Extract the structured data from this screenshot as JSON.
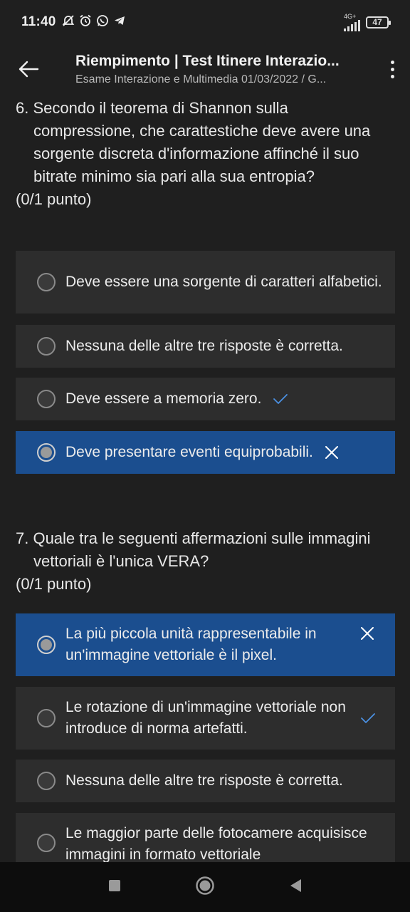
{
  "status_bar": {
    "time": "11:40",
    "network_label": "4G+",
    "battery": "47"
  },
  "app_bar": {
    "title": "Riempimento | Test Itinere Interazio...",
    "subtitle": "Esame Interazione e Multimedia 01/03/2022 / G..."
  },
  "questions": [
    {
      "text": "6. Secondo il teorema di Shannon sulla compressione, che carattestiche deve avere una sorgente discreta d'informazione affinché il suo bitrate minimo sia pari alla sua entropia?",
      "points": "(0/1 punto)",
      "options": [
        {
          "label": "Deve essere una sorgente di caratteri alfabetici.",
          "selected": false,
          "mark": "none"
        },
        {
          "label": "Nessuna delle altre tre risposte è corretta.",
          "selected": false,
          "mark": "none"
        },
        {
          "label": "Deve essere a memoria zero.",
          "selected": false,
          "mark": "correct"
        },
        {
          "label": "Deve presentare eventi equiprobabili.",
          "selected": true,
          "mark": "wrong"
        }
      ]
    },
    {
      "text": "7. Quale tra le seguenti affermazioni sulle immagini vettoriali è l'unica VERA?",
      "points": "(0/1 punto)",
      "options": [
        {
          "label": "La più piccola unità rappresentabile in un'immagine vettoriale è il pixel.",
          "selected": true,
          "mark": "wrong"
        },
        {
          "label": "Le rotazione di un'immagine vettoriale non introduce di norma artefatti.",
          "selected": false,
          "mark": "correct"
        },
        {
          "label": "Nessuna delle altre tre risposte è corretta.",
          "selected": false,
          "mark": "none"
        },
        {
          "label": "Le maggior parte delle fotocamere acquisisce immagini in formato vettoriale",
          "selected": false,
          "mark": "none"
        }
      ]
    }
  ],
  "colors": {
    "background": "#1f1f1f",
    "option_bg": "#2d2d2d",
    "selected_bg": "#1b4e8f",
    "correct_mark": "#4a90e2",
    "wrong_mark": "#ffffff"
  },
  "icons": {
    "back": "arrow-left-icon",
    "menu": "more-vert-icon",
    "correct": "check-icon",
    "wrong": "close-icon"
  }
}
